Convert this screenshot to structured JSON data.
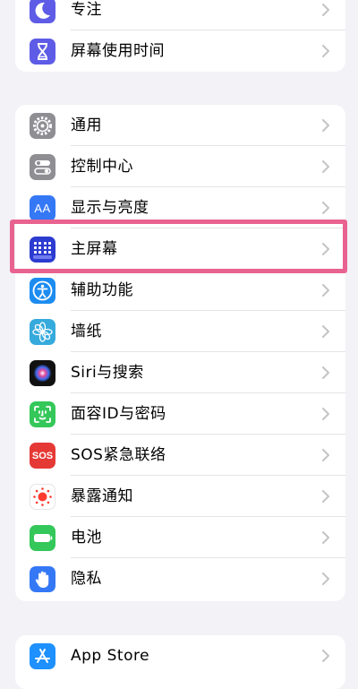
{
  "group1": {
    "items": [
      {
        "label": "专注",
        "icon": "moon-icon",
        "color": "#5e5ce6"
      },
      {
        "label": "屏幕使用时间",
        "icon": "hourglass-icon",
        "color": "#5e5ce6"
      }
    ]
  },
  "group2": {
    "items": [
      {
        "label": "通用",
        "icon": "gear-icon",
        "color": "#8e8e93"
      },
      {
        "label": "控制中心",
        "icon": "toggles-icon",
        "color": "#8e8e93"
      },
      {
        "label": "显示与亮度",
        "icon": "text-size-icon",
        "color": "#3478f6"
      },
      {
        "label": "主屏幕",
        "icon": "home-grid-icon",
        "color": "#2c3bd0"
      },
      {
        "label": "辅助功能",
        "icon": "accessibility-icon",
        "color": "#1c8cf0"
      },
      {
        "label": "墙纸",
        "icon": "flower-icon",
        "color": "#36aadc"
      },
      {
        "label": "Siri与搜索",
        "icon": "siri-icon",
        "color": "#111111"
      },
      {
        "label": "面容ID与密码",
        "icon": "face-id-icon",
        "color": "#34c759"
      },
      {
        "label": "SOS紧急联络",
        "icon": "sos-icon",
        "color": "#e53935"
      },
      {
        "label": "暴露通知",
        "icon": "exposure-icon",
        "color": "#ffffff"
      },
      {
        "label": "电池",
        "icon": "battery-icon",
        "color": "#34c759"
      },
      {
        "label": "隐私",
        "icon": "hand-icon",
        "color": "#3478f6"
      }
    ]
  },
  "group3": {
    "items": [
      {
        "label": "App Store",
        "icon": "app-store-icon",
        "color": "#1e90ff"
      }
    ]
  },
  "sos_text": "SOS",
  "aa_text": "AA",
  "highlight_color": "#e8638f"
}
